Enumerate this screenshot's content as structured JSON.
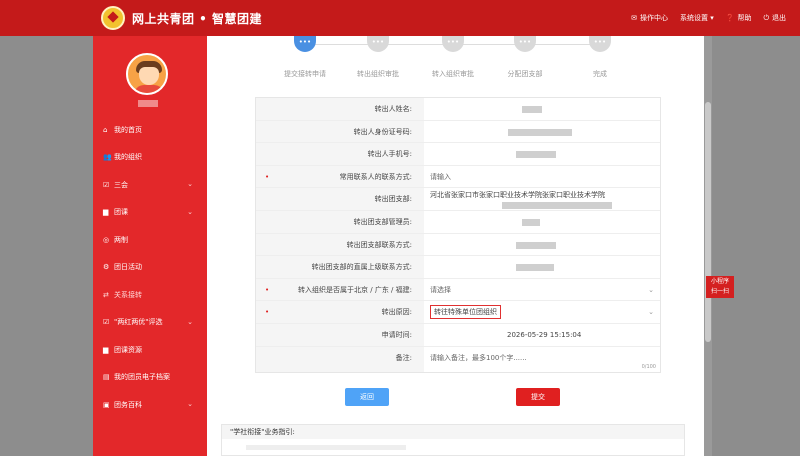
{
  "header": {
    "title": "网上共青团 • 智慧团建",
    "nav": [
      {
        "label": "操作中心",
        "icon": "envelope-icon"
      },
      {
        "label": "系统设置 ▾",
        "icon": ""
      },
      {
        "label": "帮助",
        "icon": "help-icon"
      },
      {
        "label": "退出",
        "icon": "power-icon"
      }
    ]
  },
  "sidebar": {
    "items": [
      {
        "label": "我的首页",
        "icon": "home-icon"
      },
      {
        "label": "我的组织",
        "icon": "users-icon"
      },
      {
        "label": "三会",
        "icon": "checkbox-icon",
        "arrow": true
      },
      {
        "label": "团课",
        "icon": "folder-icon",
        "arrow": true
      },
      {
        "label": "两制",
        "icon": "ring-icon"
      },
      {
        "label": "团日活动",
        "icon": "gear-icon"
      },
      {
        "label": "关系接转",
        "icon": "transfer-icon"
      },
      {
        "label": "\"两红两优\"评选",
        "icon": "checkbox-icon",
        "arrow": true
      },
      {
        "label": "团课资源",
        "icon": "folder-icon"
      },
      {
        "label": "我的团员电子档案",
        "icon": "file-icon"
      },
      {
        "label": "团务百科",
        "icon": "book-icon",
        "arrow": true
      }
    ]
  },
  "steps": [
    {
      "label": "提交接转申请",
      "active": true
    },
    {
      "label": "转出组织审批",
      "active": false
    },
    {
      "label": "转入组织审批",
      "active": false
    },
    {
      "label": "分配团支部",
      "active": false
    },
    {
      "label": "完成",
      "active": false
    }
  ],
  "form": {
    "rows": [
      {
        "label": "转出人姓名:",
        "value": ""
      },
      {
        "label": "转出人身份证号码:",
        "value": ""
      },
      {
        "label": "转出人手机号:",
        "value": ""
      },
      {
        "label": "常用联系人的联系方式:",
        "required": true,
        "value": "请输入"
      },
      {
        "label": "转出团支部:",
        "value": "河北省张家口市张家口职业技术学院张家口职业技术学院"
      },
      {
        "label": "转出团支部管理员:",
        "value": ""
      },
      {
        "label": "转出团支部联系方式:",
        "value": ""
      },
      {
        "label": "转出团支部的直属上级联系方式:",
        "value": ""
      },
      {
        "label": "转入组织是否属于北京 / 广东 / 福建:",
        "required": true,
        "value": "请选择"
      },
      {
        "label": "转出原因:",
        "required": true,
        "value": "转往特殊单位团组织"
      },
      {
        "label": "申请时间:",
        "value": "2026-05-29 15:15:04"
      },
      {
        "label": "备注:",
        "value": "请输入备注，最多100个字......",
        "counter": "0/100"
      }
    ]
  },
  "buttons": {
    "back": "返回",
    "submit": "提交"
  },
  "guide": {
    "title": "\"学社衔接\"业务指引:"
  },
  "mini_program": {
    "line1": "小程序",
    "line2": "扫一扫"
  }
}
